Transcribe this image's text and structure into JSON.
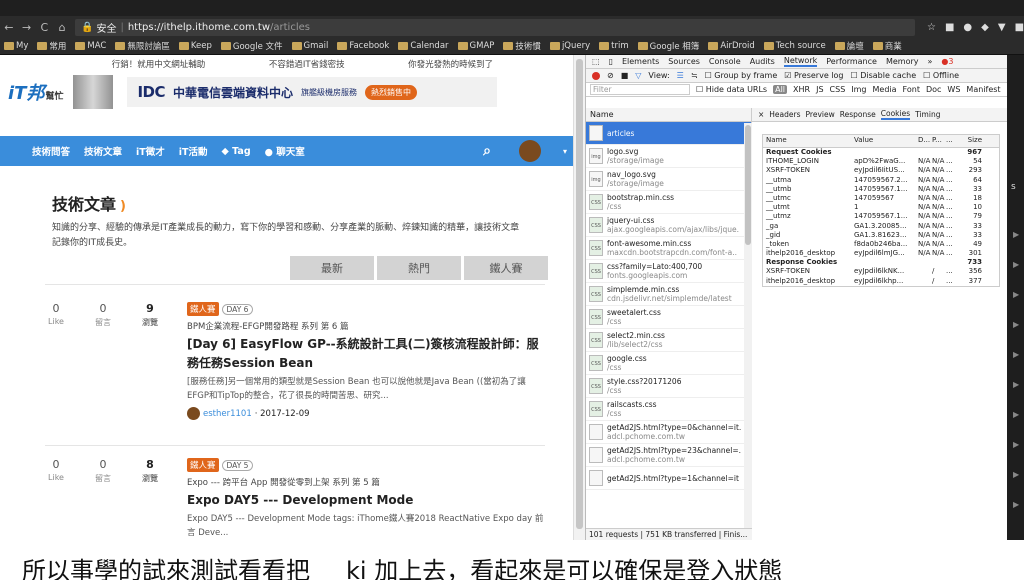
{
  "browser": {
    "url_secure": "安全",
    "url_host": "https://ithelp.ithome.com.tw",
    "url_path": "/articles",
    "bookmarks": [
      "My",
      "常用",
      "MAC",
      "無限討論區",
      "Keep",
      "Google 文件",
      "Gmail",
      "Facebook",
      "Calendar",
      "GMAP",
      "技術慣",
      "jQuery",
      "trim",
      "Google 相簿",
      "AirDroid",
      "Tech source",
      "論壇",
      "商業"
    ]
  },
  "site": {
    "promo": [
      "行銷！就用中文網址輔助",
      "不容錯過IT省錢密技",
      "你發光發熱的時候到了"
    ],
    "logo": "iT邦",
    "logo_sub": "幫忙",
    "ad_brand": "IDC",
    "ad_text": "中華電信雲端資料中心",
    "ad_sub": "旗艦級機房服務",
    "ad_button": "熱烈銷售中",
    "nav": [
      "技術問答",
      "技術文章",
      "iT徵才",
      "iT活動",
      "Tag",
      "聊天室"
    ],
    "heading": "技術文章",
    "intro": "知識的分享、經驗的傳承是IT產業成長的動力，寫下你的學習和感動、分享產業的脈動、焠鍊知識的精華，讓技術文章記錄你的IT成長史。",
    "tabs": [
      "最新",
      "熱門",
      "鐵人賽"
    ],
    "articles": [
      {
        "like": "0",
        "like_label": "Like",
        "comments": "0",
        "comments_label": "留言",
        "views": "9",
        "views_label": "瀏覽",
        "tag": "鐵人賽",
        "day": "DAY 6",
        "series": "BPM企業流程-EFGP開發路程 系列 第 6 篇",
        "title": "[Day 6] EasyFlow GP--系統設計工具(二)簽核流程設計師：服務任務Session Bean",
        "desc": "[服務任務]另一個常用的類型就是Session Bean 也可以說他就是Java Bean ((當初為了讓EFGP和TipTop的整合，花了很長的時間苦思、研究...",
        "author": "esther1101",
        "date": " · 2017-12-09"
      },
      {
        "like": "0",
        "like_label": "Like",
        "comments": "0",
        "comments_label": "留言",
        "views": "8",
        "views_label": "瀏覽",
        "tag": "鐵人賽",
        "day": "DAY 5",
        "series": "Expo --- 跨平台 App 開發從零到上架 系列 第 5 篇",
        "title": "Expo DAY5 --- Development Mode",
        "desc": "Expo DAY5 --- Development Mode tags: iThome鐵人賽2018 ReactNative Expo day 前言 Deve...",
        "author": "",
        "date": ""
      }
    ]
  },
  "devtools": {
    "tabs": [
      "Elements",
      "Sources",
      "Console",
      "Audits",
      "Network",
      "Performance",
      "Memory",
      "»"
    ],
    "errors": "3",
    "toolbar": [
      "View:",
      "Group by frame",
      "Preserve log",
      "Disable cache",
      "Offline",
      "O"
    ],
    "filter_placeholder": "Filter",
    "filter_opts": [
      "Hide data URLs",
      "All",
      "XHR",
      "JS",
      "CSS",
      "Img",
      "Media",
      "Font",
      "Doc",
      "WS",
      "Manifest"
    ],
    "list_header": "Name",
    "requests": [
      {
        "name": "articles",
        "path": "",
        "icon": "doc"
      },
      {
        "name": "logo.svg",
        "path": "/storage/image",
        "icon": "img"
      },
      {
        "name": "nav_logo.svg",
        "path": "/storage/image",
        "icon": "img"
      },
      {
        "name": "bootstrap.min.css",
        "path": "/css",
        "icon": "css"
      },
      {
        "name": "jquery-ui.css",
        "path": "ajax.googleapis.com/ajax/libs/jque.",
        "icon": "css"
      },
      {
        "name": "font-awesome.min.css",
        "path": "maxcdn.bootstrapcdn.com/font-a..",
        "icon": "css"
      },
      {
        "name": "css?family=Lato:400,700",
        "path": "fonts.googleapis.com",
        "icon": "css"
      },
      {
        "name": "simplemde.min.css",
        "path": "cdn.jsdelivr.net/simplemde/latest",
        "icon": "css"
      },
      {
        "name": "sweetalert.css",
        "path": "/css",
        "icon": "css"
      },
      {
        "name": "select2.min.css",
        "path": "/lib/select2/css",
        "icon": "css"
      },
      {
        "name": "google.css",
        "path": "/css",
        "icon": "css"
      },
      {
        "name": "style.css?20171206",
        "path": "/css",
        "icon": "css"
      },
      {
        "name": "railscasts.css",
        "path": "/css",
        "icon": "css"
      },
      {
        "name": "getAd2JS.html?type=0&channel=it.",
        "path": "adcl.pchome.com.tw",
        "icon": "doc"
      },
      {
        "name": "getAd2JS.html?type=23&channel=.",
        "path": "adcl.pchome.com.tw",
        "icon": "doc"
      },
      {
        "name": "getAd2JS.html?type=1&channel=it",
        "path": "",
        "icon": "doc"
      }
    ],
    "footer": "101 requests | 751 KB transferred | Finis...",
    "detail_tabs": [
      "×",
      "Headers",
      "Preview",
      "Response",
      "Cookies",
      "Timing"
    ],
    "cookie_cols": [
      "Name",
      "Value",
      "D...",
      "P...",
      "...",
      "Size",
      "..."
    ],
    "cookie_rows": [
      {
        "n": "Request Cookies",
        "v": "",
        "d": "",
        "p": "",
        "e": "",
        "s": "967",
        "sec": true
      },
      {
        "n": "ITHOME_LOGIN",
        "v": "apD%2FwaG...",
        "d": "N/A",
        "p": "N/A",
        "e": "...",
        "s": "54"
      },
      {
        "n": "XSRF-TOKEN",
        "v": "eyJpdil6IitUS...",
        "d": "N/A",
        "p": "N/A",
        "e": "...",
        "s": "293"
      },
      {
        "n": "__utma",
        "v": "147059567.2...",
        "d": "N/A",
        "p": "N/A",
        "e": "...",
        "s": "64"
      },
      {
        "n": "__utmb",
        "v": "147059567.1...",
        "d": "N/A",
        "p": "N/A",
        "e": "...",
        "s": "33"
      },
      {
        "n": "__utmc",
        "v": "147059567",
        "d": "N/A",
        "p": "N/A",
        "e": "...",
        "s": "18"
      },
      {
        "n": "__utmt",
        "v": "1",
        "d": "N/A",
        "p": "N/A",
        "e": "...",
        "s": "10"
      },
      {
        "n": "__utmz",
        "v": "147059567.1...",
        "d": "N/A",
        "p": "N/A",
        "e": "...",
        "s": "79"
      },
      {
        "n": "_ga",
        "v": "GA1.3.20085...",
        "d": "N/A",
        "p": "N/A",
        "e": "...",
        "s": "33"
      },
      {
        "n": "_gid",
        "v": "GA1.3.81623...",
        "d": "N/A",
        "p": "N/A",
        "e": "...",
        "s": "33"
      },
      {
        "n": "_token",
        "v": "f8da0b246ba...",
        "d": "N/A",
        "p": "N/A",
        "e": "...",
        "s": "49"
      },
      {
        "n": "ithelp2016_desktop",
        "v": "eyJpdil6lmJG...",
        "d": "N/A",
        "p": "N/A",
        "e": "...",
        "s": "301"
      },
      {
        "n": "Response Cookies",
        "v": "",
        "d": "",
        "p": "",
        "e": "",
        "s": "733",
        "sec": true
      },
      {
        "n": "XSRF-TOKEN",
        "v": "eyJpdil6lkNK...",
        "d": "",
        "p": "/",
        "e": "...",
        "s": "356"
      },
      {
        "n": "ithelp2016_desktop",
        "v": "eyJpdil6lkhp...",
        "d": "",
        "p": "/",
        "e": "...",
        "s": "377"
      }
    ]
  },
  "caption": "所以事學的試來測試看看把___ki 加上去，看起來是可以確保是登入狀態"
}
